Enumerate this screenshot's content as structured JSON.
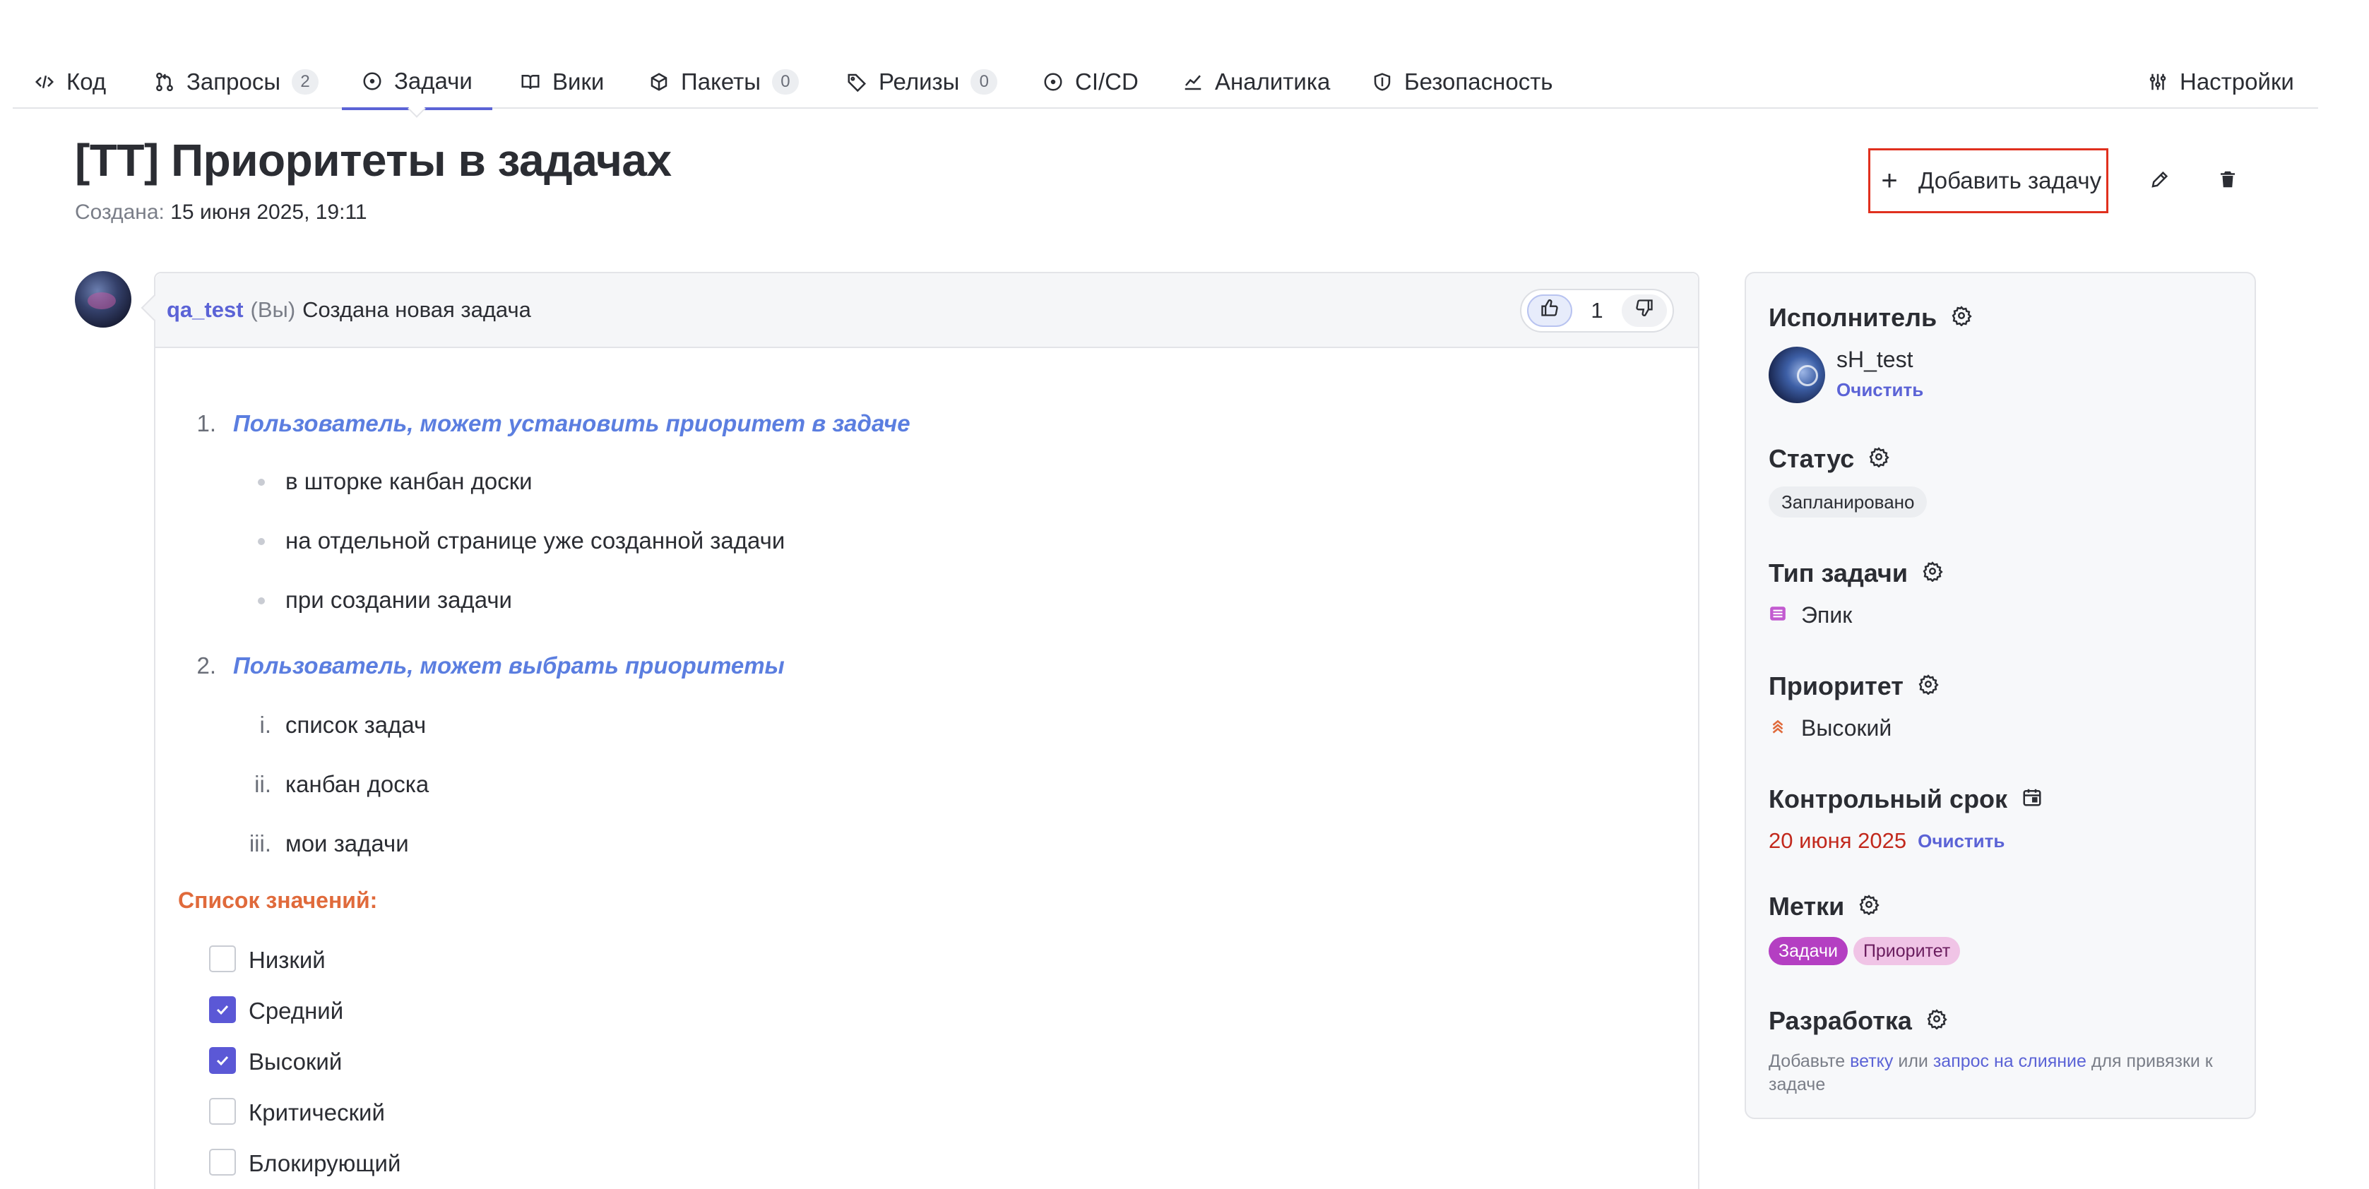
{
  "nav": {
    "tabs": [
      {
        "label": "Код",
        "icon": "code-icon"
      },
      {
        "label": "Запросы",
        "count": "2",
        "icon": "merge-request-icon"
      },
      {
        "label": "Задачи",
        "icon": "issues-icon",
        "active": true
      },
      {
        "label": "Вики",
        "icon": "book-icon"
      },
      {
        "label": "Пакеты",
        "count": "0",
        "icon": "package-icon"
      },
      {
        "label": "Релизы",
        "count": "0",
        "icon": "tag-icon"
      },
      {
        "label": "CI/CD",
        "icon": "pipeline-icon"
      },
      {
        "label": "Аналитика",
        "icon": "chart-icon"
      },
      {
        "label": "Безопасность",
        "icon": "shield-icon"
      }
    ],
    "settings_label": "Настройки"
  },
  "issue": {
    "title": "[TT] Приоритеты в задачах",
    "created_label": "Создана:",
    "created_value": "15 июня 2025, 19:11",
    "add_task_label": "Добавить задачу"
  },
  "comment": {
    "author": "qa_test",
    "you": "(Вы)",
    "action": "Создана новая задача",
    "likes": "1",
    "items": [
      {
        "num": "1.",
        "title": "Пользователь, может установить приоритет в задаче",
        "bullets": [
          "в шторке канбан доски",
          "на отдельной странице уже созданной задачи",
          "при создании задачи"
        ]
      },
      {
        "num": "2.",
        "title": "Пользователь, может выбрать приоритеты",
        "subs": [
          {
            "num": "i.",
            "text": "список задач"
          },
          {
            "num": "ii.",
            "text": "канбан доска"
          },
          {
            "num": "iii.",
            "text": "мои задачи"
          }
        ]
      }
    ],
    "values_title": "Список значений:",
    "checkboxes": [
      {
        "label": "Низкий",
        "checked": false
      },
      {
        "label": "Средний",
        "checked": true
      },
      {
        "label": "Высокий",
        "checked": true
      },
      {
        "label": "Критический",
        "checked": false
      },
      {
        "label": "Блокирующий",
        "checked": false
      }
    ]
  },
  "sidebar": {
    "assignee_title": "Исполнитель",
    "assignee_name": "sH_test",
    "clear_label": "Очистить",
    "status_title": "Статус",
    "status_value": "Запланировано",
    "type_title": "Тип задачи",
    "type_value": "Эпик",
    "priority_title": "Приоритет",
    "priority_value": "Высокий",
    "deadline_title": "Контрольный срок",
    "deadline_value": "20 июня 2025",
    "labels_title": "Метки",
    "labels": [
      "Задачи",
      "Приоритет"
    ],
    "dev_title": "Разработка",
    "dev_text_1": "Добавьте",
    "dev_link_1": "ветку",
    "dev_text_2": "или",
    "dev_link_2": "запрос на слияние",
    "dev_text_3": "для привязки к задаче"
  },
  "colors": {
    "accent": "#5b63d6",
    "link_italic": "#5b7ee0",
    "values_title": "#e06a3b",
    "deadline": "#c2291d",
    "highlight_border": "#e0301e",
    "label_tasks": "#b43fc2",
    "label_priority": "#f0c4e6"
  }
}
